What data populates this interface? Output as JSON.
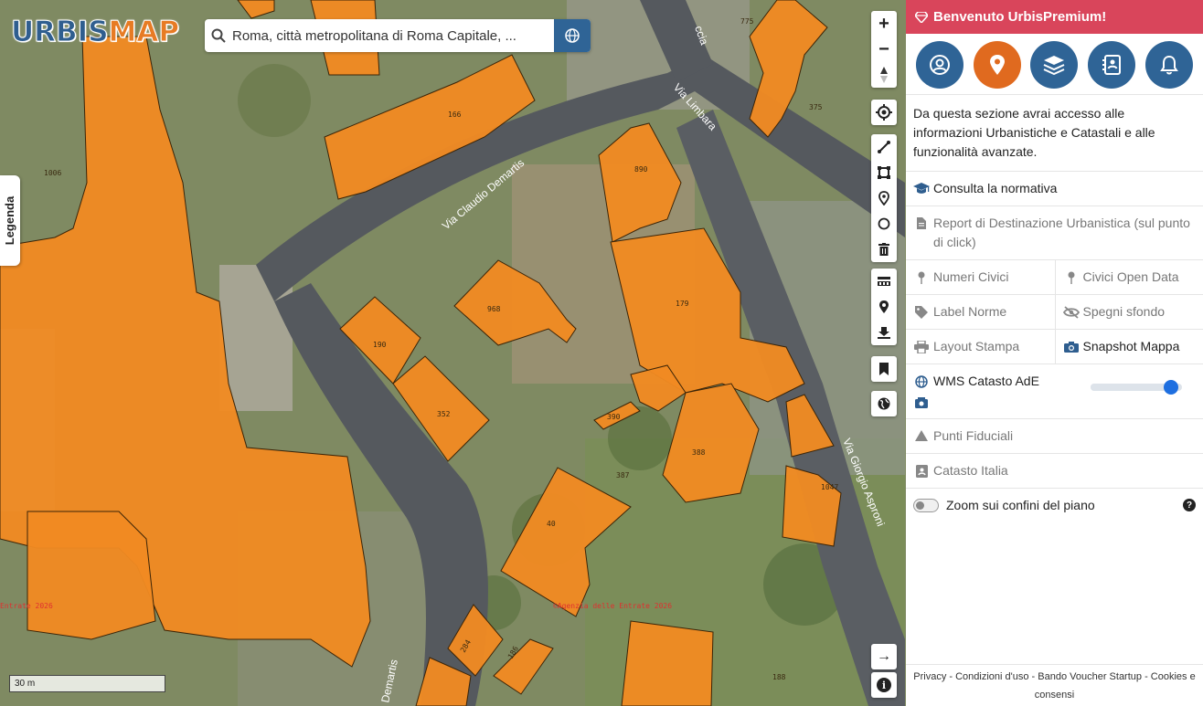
{
  "map": {
    "logo_part1": "URBIS",
    "logo_part2": "MAP",
    "search": {
      "value": "Roma, città metropolitana di Roma Capitale, ..."
    },
    "legenda_label": "Legenda",
    "scale_label": "30 m",
    "streets": [
      "Via Claudio Demartis",
      "Via Limbara",
      "Via Giorgio Asproni",
      "Demartis"
    ],
    "parcel_numbers": [
      "166",
      "1006",
      "890",
      "968",
      "190",
      "179",
      "352",
      "390",
      "388",
      "387",
      "40",
      "1047",
      "375",
      "775",
      "284",
      "186",
      "188"
    ],
    "watermark": "Agenzia delle Entrate 2026",
    "watermark_partial": "Entrate 2026",
    "colors": {
      "parcel_fill": "#f08a22",
      "parcel_stroke": "#3b2407",
      "road": "#55595e"
    }
  },
  "toolbar": {
    "zoom": [
      "zoom-in-icon",
      "zoom-out-icon",
      "compass-icon"
    ],
    "zoom_in_glyph": "+",
    "zoom_out_glyph": "−",
    "tools": [
      "locate-icon",
      "draw-line-icon",
      "draw-polygon-icon",
      "marker-icon",
      "circle-icon",
      "trash-icon",
      "layers-stack-icon",
      "pin-icon",
      "download-icon"
    ],
    "arrow_glyph": "→",
    "info_glyph": "i"
  },
  "panel": {
    "banner": "Benvenuto UrbisPremium!",
    "tabs": [
      "user-icon",
      "location-icon",
      "layers-icon",
      "contacts-icon",
      "bell-icon"
    ],
    "intro": "Da questa sezione avrai accesso alle informazioni Urbanistiche e Catastali e alle funzionalità avanzate.",
    "consulta": "Consulta la normativa",
    "report": "Report di Destinazione Urbanistica (sul punto di click)",
    "numeri_civici": "Numeri Civici",
    "civici_open_data": "Civici Open Data",
    "label_norme": "Label Norme",
    "spegni_sfondo": "Spegni sfondo",
    "layout_stampa": "Layout Stampa",
    "snapshot_mappa": "Snapshot Mappa",
    "wms_catasto": "WMS Catasto AdE",
    "wms_opacity": 0.95,
    "punti_fiduciali": "Punti Fiduciali",
    "catasto_italia": "Catasto Italia",
    "zoom_confini": "Zoom sui confini del piano",
    "help_glyph": "?",
    "footer": "Privacy - Condizioni d'uso - Bando Voucher Startup - Cookies e consensi",
    "colors": {
      "banner": "#d9455b",
      "tab": "#2f6496",
      "tab_active": "#e06a1f",
      "slider_knob": "#1e6fe0"
    }
  }
}
